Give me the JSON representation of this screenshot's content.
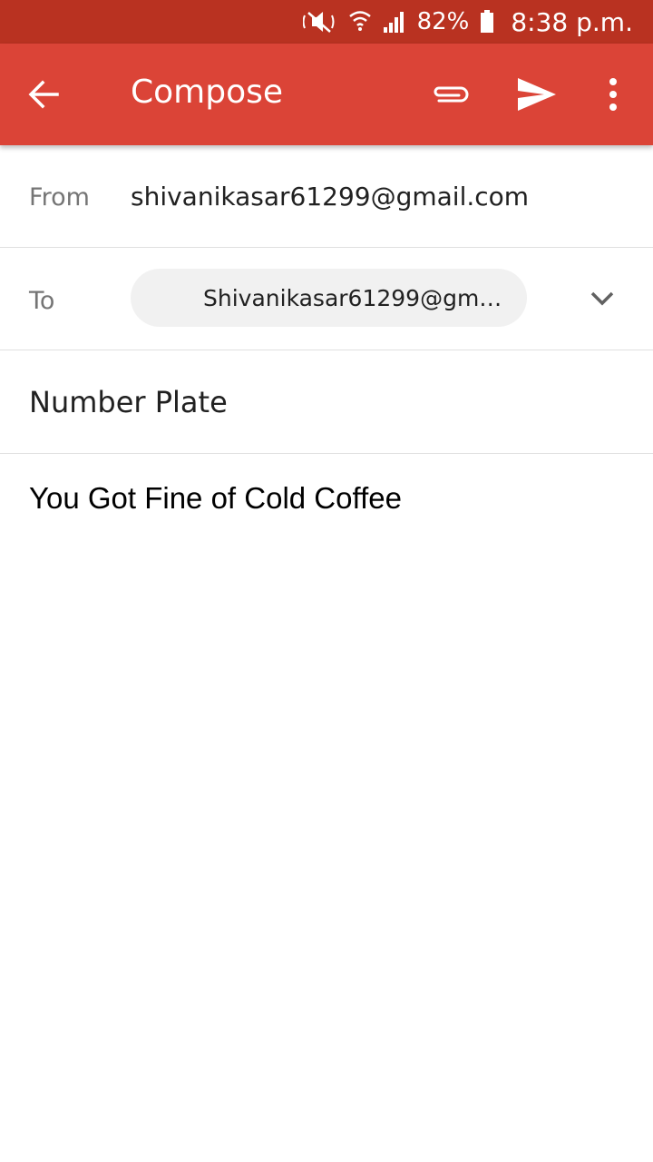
{
  "status_bar": {
    "battery": "82%",
    "time": "8:38 p.m.",
    "icons": [
      "mute-icon",
      "wifi-icon",
      "signal-icon",
      "battery-icon"
    ]
  },
  "app_bar": {
    "title": "Compose",
    "icons": [
      "back-arrow-icon",
      "attach-icon",
      "send-icon",
      "more-vert-icon"
    ],
    "color": "#db4437"
  },
  "form": {
    "from_label": "From",
    "from_value": "shivanikasar61299@gmail.com",
    "to_label": "To",
    "to_chip": "Shivanikasar61299@gmai...",
    "subject": "Number Plate",
    "body": "You Got Fine of Cold Coffee"
  }
}
